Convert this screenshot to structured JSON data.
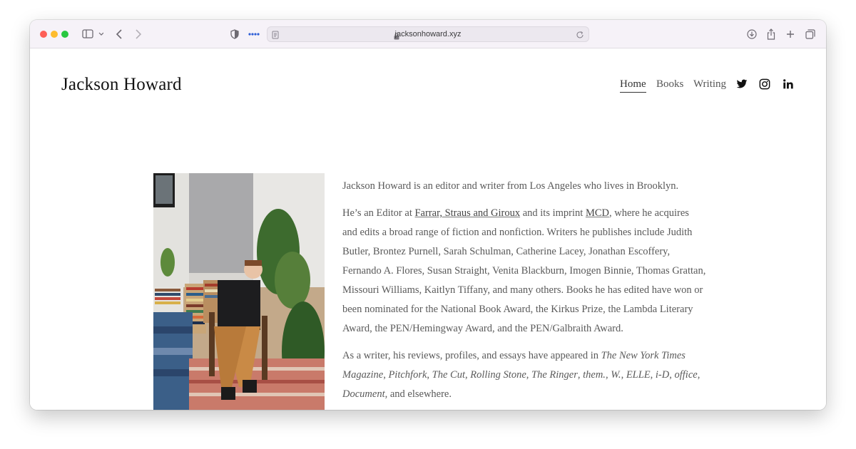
{
  "browser": {
    "url": "jacksonhoward.xyz",
    "traffic_lights": {
      "close": "#fe5f57",
      "minimize": "#febc2e",
      "zoom": "#28c840"
    }
  },
  "site": {
    "title": "Jackson Howard",
    "nav": [
      {
        "label": "Home",
        "active": true
      },
      {
        "label": "Books",
        "active": false
      },
      {
        "label": "Writing",
        "active": false
      }
    ],
    "social_icons": [
      "twitter-icon",
      "instagram-icon",
      "linkedin-icon"
    ]
  },
  "bio": {
    "p1": "Jackson Howard is an editor and writer from Los Angeles who lives in Brooklyn.",
    "p2": {
      "t1": "He’s an Editor at ",
      "link1": "Farrar, Straus and Giroux",
      "t2": " and its imprint ",
      "link2": "MCD",
      "t3": ", where he acquires and edits a broad range of fiction and nonfiction. Writers he publishes include Judith Butler, Brontez Purnell, Sarah Schulman, Catherine Lacey, Jonathan Escoffery, Fernando A. Flores, Susan Straight, Venita Blackburn, Imogen Binnie, Thomas Grattan,  Missouri Williams, Kaitlyn Tiffany, and many others. Books he has edited have won or been nominated for the National Book Award, the Kirkus Prize, the Lambda Literary Award, the PEN/Hemingway Award, and the PEN/Galbraith Award."
    },
    "p3": {
      "t1": "As a writer, his reviews, profiles, and essays have appeared in ",
      "pubs": [
        "The New York Times Magazine",
        "Pitchfork",
        "The Cut",
        "Rolling Stone",
        "The Ringer",
        "them.",
        "W.",
        "ELLE",
        "i-D",
        "office",
        "Document"
      ],
      "seps": [
        ", ",
        ", ",
        ", ",
        ", ",
        ", ",
        ", ",
        ", ",
        ", ",
        ", ",
        ", "
      ],
      "t2": ", and elsewhere."
    }
  }
}
